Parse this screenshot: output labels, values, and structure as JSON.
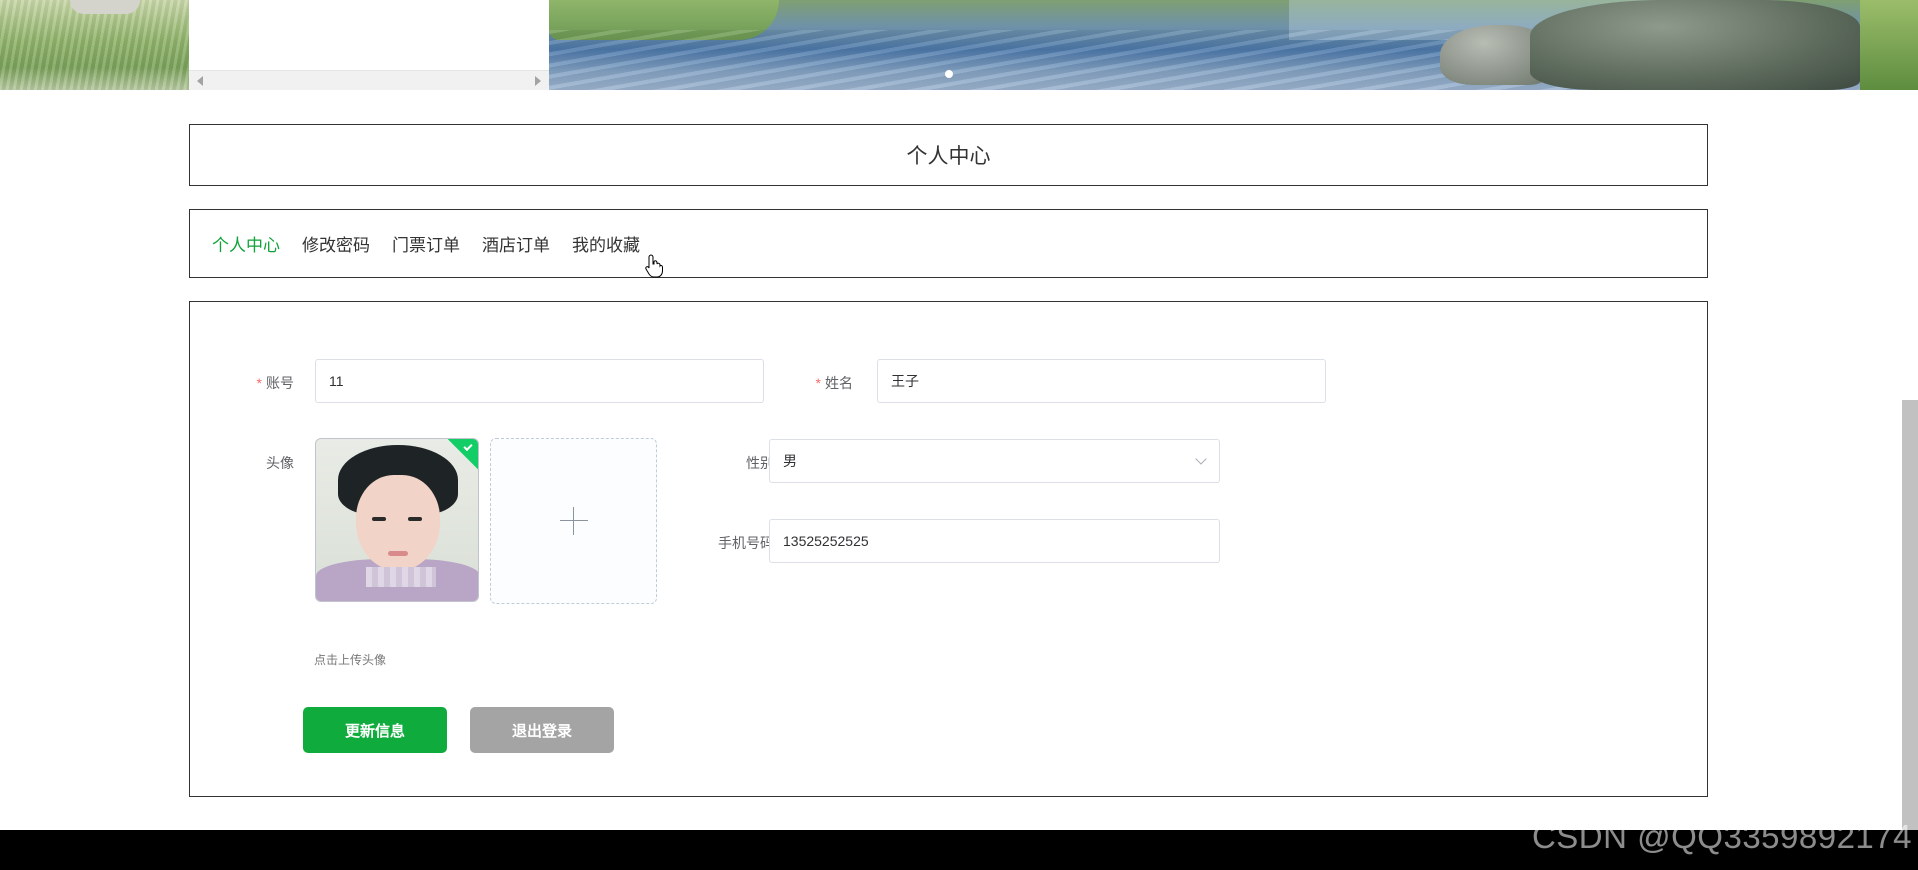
{
  "banner": {
    "images": [
      "grass-left",
      "water-rocks"
    ]
  },
  "page_title": "个人中心",
  "nav": {
    "tabs": [
      {
        "label": "个人中心",
        "active": true
      },
      {
        "label": "修改密码",
        "active": false
      },
      {
        "label": "门票订单",
        "active": false
      },
      {
        "label": "酒店订单",
        "active": false
      },
      {
        "label": "我的收藏",
        "active": false
      }
    ]
  },
  "form": {
    "account": {
      "label": "账号",
      "required": true,
      "value": "11"
    },
    "name": {
      "label": "姓名",
      "required": true,
      "value": "王子"
    },
    "avatar": {
      "label": "头像",
      "upload_hint": "点击上传头像"
    },
    "gender": {
      "label": "性别",
      "value": "男"
    },
    "phone": {
      "label": "手机号码",
      "value": "13525252525"
    },
    "buttons": {
      "update": "更新信息",
      "logout": "退出登录"
    }
  },
  "colors": {
    "accent": "#10a33a",
    "button_primary": "#0fac3d",
    "button_secondary": "#a4a4a4",
    "required": "#f56c6c"
  },
  "watermark": "CSDN @QQ3359892174"
}
